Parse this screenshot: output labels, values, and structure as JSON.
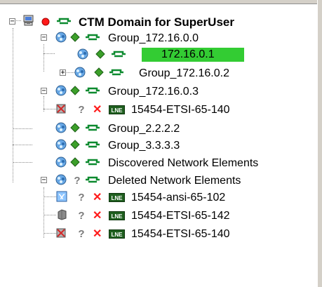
{
  "tree": {
    "root": {
      "label": "CTM Domain for SuperUser",
      "toggle": "−"
    },
    "nodes": [
      {
        "label": "Group_172.16.0.0",
        "toggle": "−"
      },
      {
        "label": "172.16.0.1",
        "selected": true
      },
      {
        "label": "Group_172.16.0.2",
        "toggle": "+"
      },
      {
        "label": "Group_172.16.0.3",
        "toggle": "−"
      },
      {
        "label": "15454-ETSI-65-140",
        "badge": "LNE"
      },
      {
        "label": "Group_2.2.2.2"
      },
      {
        "label": "Group_3.3.3.3"
      },
      {
        "label": "Discovered Network Elements"
      },
      {
        "label": "Deleted Network Elements",
        "toggle": "−"
      },
      {
        "label": "15454-ansi-65-102",
        "badge": "LNE"
      },
      {
        "label": "15454-ETSI-65-142",
        "badge": "LNE"
      },
      {
        "label": "15454-ETSI-65-140",
        "badge": "LNE"
      }
    ]
  },
  "icons": {
    "computer": "computer-icon",
    "red_dot": "red-status-dot-icon",
    "green_diamond": "green-diamond-icon",
    "gray_question": "question-mark-icon",
    "red_x": "red-x-icon",
    "network_group": "network-group-icon",
    "node": "node-icon",
    "device_crossed": "crossed-device-icon",
    "device_gray": "gray-device-icon",
    "device_blue": "blue-switch-icon"
  },
  "colors": {
    "selection": "#33cc33",
    "red": "#ff1a1a",
    "green": "#1fa01f",
    "lne_bg": "#1f5f1f"
  }
}
